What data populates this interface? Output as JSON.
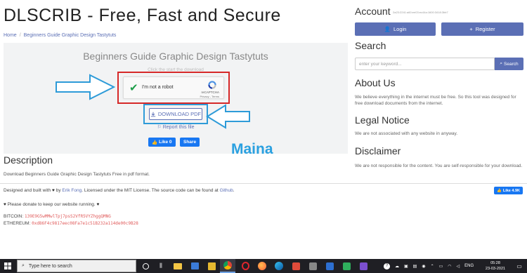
{
  "site_title": "DLSCRIB - Free, Fast and Secure",
  "breadcrumb": {
    "home": "Home",
    "current": "Beginners Guide Graphic Design Tastytuts"
  },
  "document": {
    "title": "Beginners Guide Graphic Design Tastytuts",
    "click_hint": "Click the start the download",
    "captcha_label": "I'm not a robot",
    "captcha_brand": "reCAPTCHA",
    "captcha_terms": "Privacy - Terms",
    "download_label": "DOWNLOAD PDF",
    "report_label": "Report this file",
    "like_label": "Like 0",
    "share_label": "Share"
  },
  "annotation_text": "Maina",
  "description": {
    "heading": "Description",
    "text": "Download Beginners Guide Graphic Design Tastytuts Free in pdf format."
  },
  "sidebar": {
    "account_heading": "Account",
    "account_small": "2a23:2241:a60:ee03:ec44a:1600:3418:3bb7",
    "login_label": "Login",
    "register_label": "Register",
    "search_heading": "Search",
    "search_placeholder": "enter your keyword...",
    "search_button": "Search",
    "about_heading": "About Us",
    "about_text": "We believe everything in the internet must be free. So this tool was designed for free download documents from the internet.",
    "legal_heading": "Legal Notice",
    "legal_text": "We are not associated with any website in anyway.",
    "disclaimer_heading": "Disclaimer",
    "disclaimer_text": "We are not responsible for the content. You are self-responsible for your download."
  },
  "footer": {
    "line1_a": "Designed and built with",
    "line1_b": "by",
    "author": "Erik Fong",
    "line1_c": ". Licensed under the MIT License. The source code can be found at",
    "github": "Github",
    "line1_d": ".",
    "donate": "Please donate to keep our website running.",
    "btc_label": "BITCOIN:",
    "btc_addr": "139E9G5wMMwlTpj7psS2VfR5VYZhggQMNG",
    "eth_label": "ETHEREUM:",
    "eth_addr": "0xd86F4c9817eec08Fa7e1c51B232a114de00c9B28",
    "fb_like": "Like 4.9K"
  },
  "taskbar": {
    "search_placeholder": "Type here to search",
    "lang": "ENG",
    "time": "05:28",
    "date": "23-03-2021"
  },
  "colors": {
    "accent": "#5b6fb5",
    "facebook": "#1877f2",
    "annotation": "#2aa0e0",
    "highlight_red": "#d62828"
  }
}
